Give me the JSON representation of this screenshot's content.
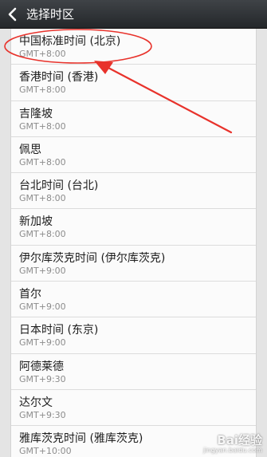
{
  "header": {
    "title": "选择时区",
    "back_icon": "chevron-left-icon"
  },
  "timezones": [
    {
      "name": "中国标准时间 (北京)",
      "offset": "GMT+8:00"
    },
    {
      "name": "香港时间 (香港)",
      "offset": "GMT+8:00"
    },
    {
      "name": "吉隆坡",
      "offset": "GMT+8:00"
    },
    {
      "name": "佩思",
      "offset": "GMT+8:00"
    },
    {
      "name": "台北时间 (台北)",
      "offset": "GMT+8:00"
    },
    {
      "name": "新加坡",
      "offset": "GMT+8:00"
    },
    {
      "name": "伊尔库茨克时间 (伊尔库茨克)",
      "offset": "GMT+9:00"
    },
    {
      "name": "首尔",
      "offset": "GMT+9:00"
    },
    {
      "name": "日本时间 (东京)",
      "offset": "GMT+9:00"
    },
    {
      "name": "阿德莱德",
      "offset": "GMT+9:30"
    },
    {
      "name": "达尔文",
      "offset": "GMT+9:30"
    },
    {
      "name": "雅库茨克时间 (雅库茨克)",
      "offset": "GMT+10:00"
    }
  ],
  "annotation": {
    "color": "#e8322b",
    "target": "中国标准时间 (北京)"
  },
  "watermark": {
    "brand": "Bai经验",
    "url": "jingyan.baidu.com"
  }
}
